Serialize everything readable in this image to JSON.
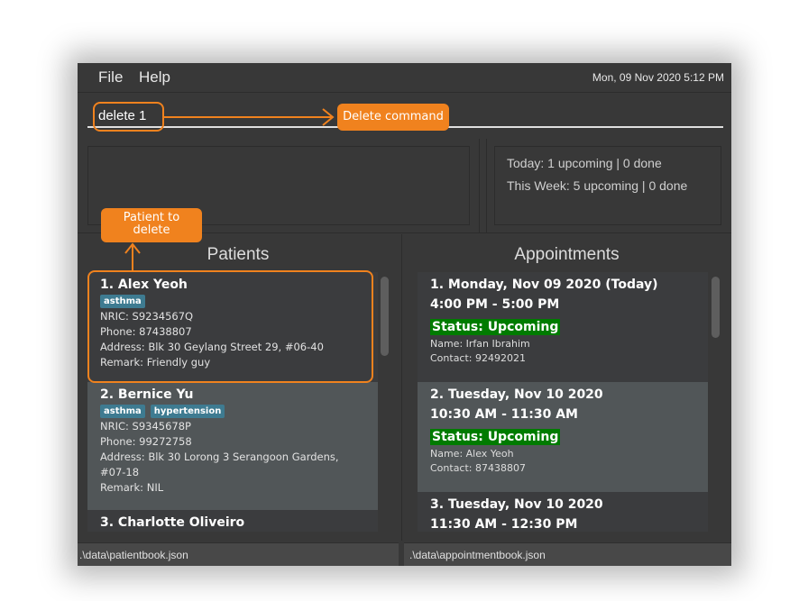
{
  "menu": {
    "items": [
      {
        "label": "File"
      },
      {
        "label": "Help"
      }
    ],
    "datetime": "Mon, 09 Nov 2020 5:12 PM"
  },
  "command": {
    "value": "delete 1"
  },
  "result_display": {
    "text": ""
  },
  "stats": {
    "today": "Today: 1 upcoming | 0 done",
    "week": "This Week: 5 upcoming | 0 done"
  },
  "patients": {
    "title": "Patients",
    "items": [
      {
        "title": "1.  Alex Yeoh",
        "tags": [
          "asthma"
        ],
        "nric": "NRIC: S9234567Q",
        "phone": "Phone: 87438807",
        "address": "Address: Blk 30 Geylang Street 29, #06-40",
        "address2": "",
        "remark": "Remark: Friendly guy"
      },
      {
        "title": "2.  Bernice Yu",
        "tags": [
          "asthma",
          "hypertension"
        ],
        "nric": "NRIC: S9345678P",
        "phone": "Phone: 99272758",
        "address": "Address: Blk 30 Lorong 3 Serangoon Gardens,",
        "address2": "#07-18",
        "remark": "Remark: NIL"
      },
      {
        "title": "3.  Charlotte Oliveiro"
      }
    ]
  },
  "appointments": {
    "title": "Appointments",
    "items": [
      {
        "title": "1.  Monday, Nov 09 2020 (Today)",
        "time": "4:00 PM - 5:00 PM",
        "status": "Status: Upcoming",
        "name": "Name: Irfan Ibrahim",
        "contact": "Contact: 92492021"
      },
      {
        "title": "2.  Tuesday, Nov 10 2020",
        "time": "10:30 AM - 11:30 AM",
        "status": "Status: Upcoming",
        "name": "Name: Alex Yeoh",
        "contact": "Contact: 87438807"
      },
      {
        "title": "3.  Tuesday, Nov 10 2020",
        "time": "11:30 AM - 12:30 PM"
      }
    ]
  },
  "statusbar": {
    "patient_file": ".\\data\\patientbook.json",
    "appointment_file": ".\\data\\appointmentbook.json"
  },
  "annotations": {
    "command_callout": "Delete command",
    "patient_callout_line1": "Patient to",
    "patient_callout_line2": "delete",
    "accent_color": "#f0821e"
  },
  "colors": {
    "status_upcoming": "#007b00",
    "tag": "#3e7b91",
    "background": "#383838"
  }
}
